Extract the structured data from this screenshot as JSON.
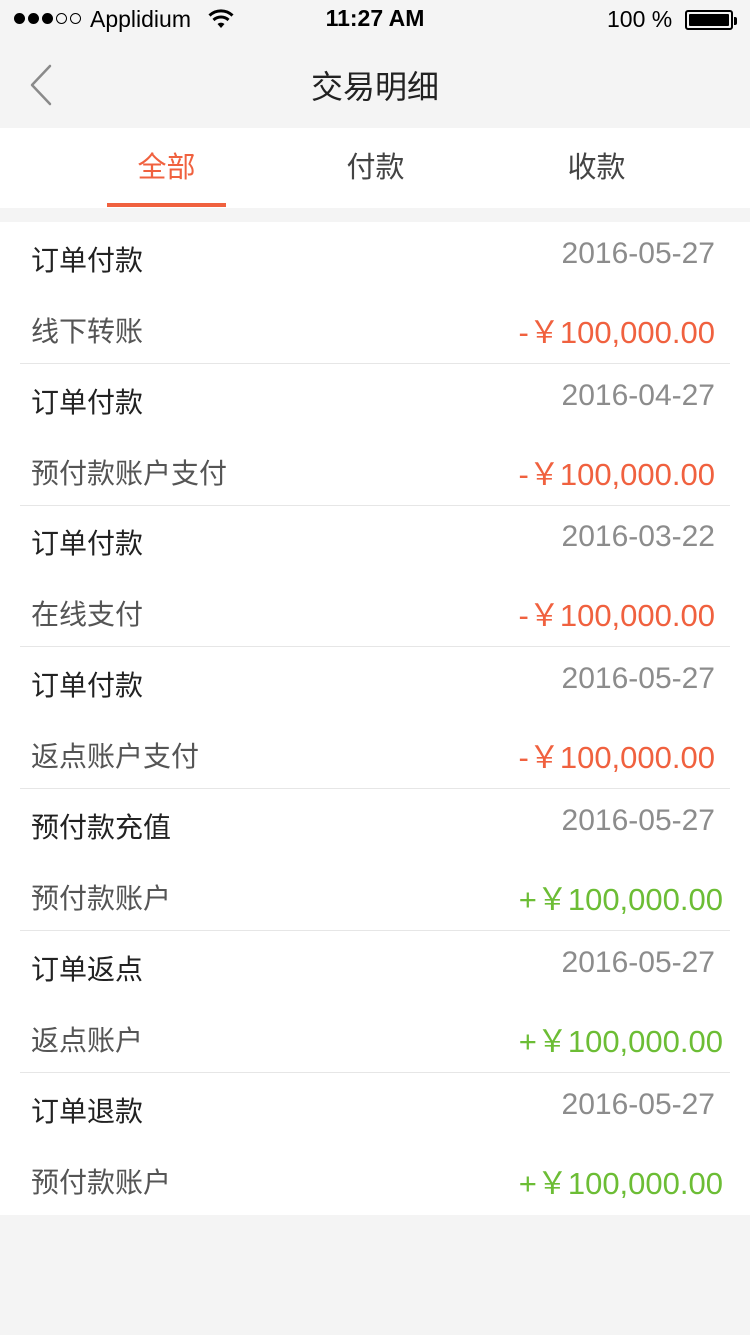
{
  "status_bar": {
    "carrier": "Applidium",
    "time": "11:27 AM",
    "battery": "100 %"
  },
  "nav": {
    "title": "交易明细",
    "back_icon": "chevron-left-icon"
  },
  "tabs": [
    {
      "label": "全部",
      "active": true
    },
    {
      "label": "付款",
      "active": false
    },
    {
      "label": "收款",
      "active": false
    }
  ],
  "colors": {
    "accent": "#f0613f",
    "positive": "#6cbd35",
    "muted": "#8c8c8c"
  },
  "transactions": [
    {
      "type": "订单付款",
      "date": "2016-05-27",
      "method": "线下转账",
      "amount": "-￥100,000.00",
      "sign": "neg"
    },
    {
      "type": "订单付款",
      "date": "2016-04-27",
      "method": "预付款账户支付",
      "amount": "-￥100,000.00",
      "sign": "neg"
    },
    {
      "type": "订单付款",
      "date": "2016-03-22",
      "method": "在线支付",
      "amount": "-￥100,000.00",
      "sign": "neg"
    },
    {
      "type": "订单付款",
      "date": "2016-05-27",
      "method": "返点账户支付",
      "amount": "-￥100,000.00",
      "sign": "neg"
    },
    {
      "type": "预付款充值",
      "date": "2016-05-27",
      "method": "预付款账户",
      "amount": "+￥100,000.00",
      "sign": "pos"
    },
    {
      "type": "订单返点",
      "date": "2016-05-27",
      "method": "返点账户",
      "amount": "+￥100,000.00",
      "sign": "pos"
    },
    {
      "type": "订单退款",
      "date": "2016-05-27",
      "method": "预付款账户",
      "amount": "+￥100,000.00",
      "sign": "pos"
    }
  ]
}
